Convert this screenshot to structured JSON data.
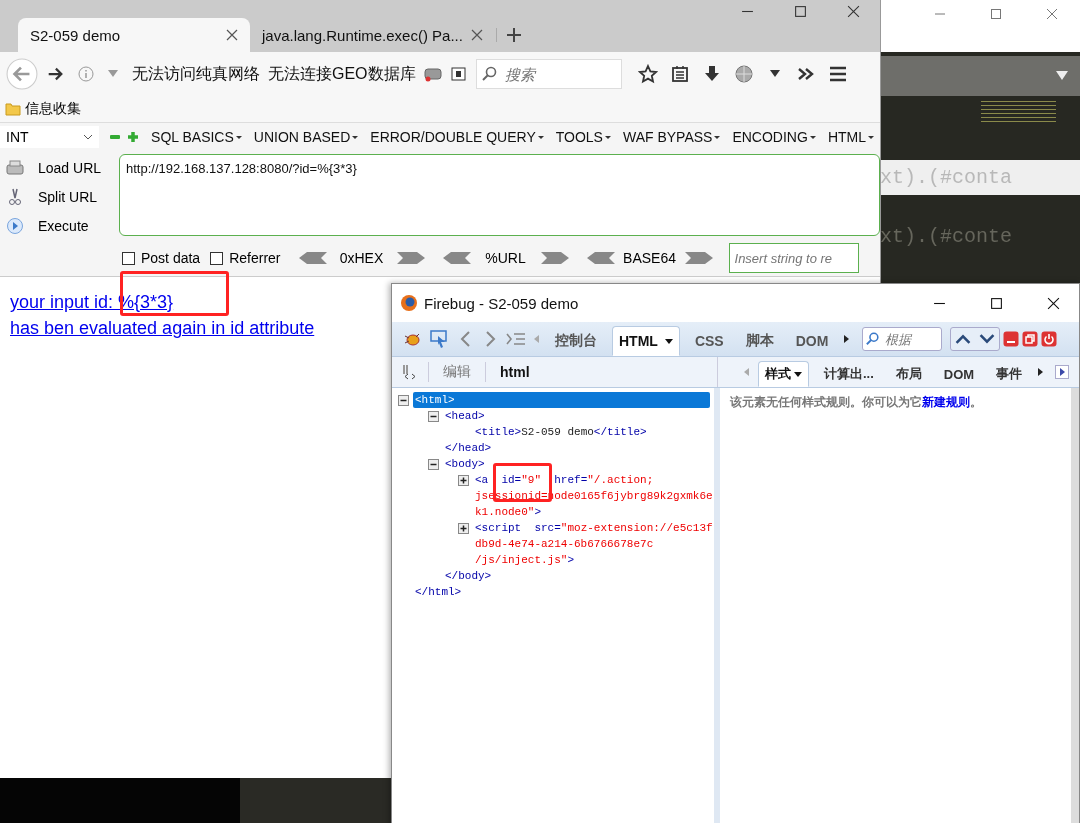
{
  "editor": {
    "code_lines": [
      "xt).(#conta",
      "xt).(#conte"
    ]
  },
  "browser": {
    "tabs": [
      {
        "label": "S2-059 demo",
        "selected": true
      },
      {
        "label": "java.lang.Runtime.exec() Pa...",
        "selected": false
      }
    ],
    "status_texts": [
      "无法访问纯真网络",
      "无法连接GEO数据库"
    ],
    "search": {
      "placeholder": "搜索"
    },
    "bookmarks": [
      "信息收集"
    ],
    "hackbar": {
      "select": "INT",
      "menus": [
        "SQL BASICS",
        "UNION BASED",
        "ERROR/DOUBLE QUERY",
        "TOOLS",
        "WAF BYPASS",
        "ENCODING",
        "HTML"
      ],
      "actions": [
        {
          "kind": "load",
          "label": "Load URL"
        },
        {
          "kind": "split",
          "label": "Split URL"
        },
        {
          "kind": "execute",
          "label": "Execute"
        }
      ],
      "url": "http://192.168.137.128:8080/?id=%{3*3}",
      "options": [
        {
          "label": "Post data",
          "checked": false
        },
        {
          "label": "Referrer",
          "checked": false
        }
      ],
      "encoders": [
        "0xHEX",
        "%URL",
        "BASE64"
      ],
      "insert": {
        "placeholder": "Insert string to re"
      }
    },
    "page_lines": [
      "your input id: %{3*3}",
      "has ben evaluated again in id attribute"
    ]
  },
  "firebug": {
    "title": "Firebug - S2-059 demo",
    "panels": [
      {
        "label": "控制台",
        "selected": false
      },
      {
        "label": "HTML",
        "selected": true
      },
      {
        "label": "CSS",
        "selected": false
      },
      {
        "label": "脚本",
        "selected": false
      },
      {
        "label": "DOM",
        "selected": false
      }
    ],
    "search": {
      "placeholder": "根据"
    },
    "edit": "编辑",
    "breadcrumb": "html",
    "side_tabs": [
      {
        "label": "样式",
        "selected": true
      },
      {
        "label": "计算出...",
        "selected": false
      },
      {
        "label": "布局",
        "selected": false
      },
      {
        "label": "DOM",
        "selected": false
      },
      {
        "label": "事件",
        "selected": false
      }
    ],
    "tree": [
      {
        "kind": "element",
        "expanded": true,
        "selected": true,
        "lines": [
          [
            {
              "kind": "tag",
              "text": "<html>"
            }
          ]
        ],
        "close": [
          {
            "kind": "tag",
            "text": "</html>"
          }
        ],
        "children": [
          {
            "kind": "element",
            "expanded": true,
            "selected": false,
            "lines": [
              [
                {
                  "kind": "tag",
                  "text": "<head>"
                }
              ]
            ],
            "close": [
              {
                "kind": "tag",
                "text": "</head>"
              }
            ],
            "children": [
              {
                "kind": "leaf",
                "selected": false,
                "lines": [
                  [
                    {
                      "kind": "tag",
                      "text": "<title>"
                    },
                    {
                      "kind": "text",
                      "text": "S2-059 demo"
                    },
                    {
                      "kind": "tag",
                      "text": "</title>"
                    }
                  ]
                ]
              }
            ]
          },
          {
            "kind": "element",
            "expanded": true,
            "selected": false,
            "lines": [
              [
                {
                  "kind": "tag",
                  "text": "<body>"
                }
              ]
            ],
            "close": [
              {
                "kind": "tag",
                "text": "</body>"
              }
            ],
            "children": [
              {
                "kind": "element",
                "expanded": false,
                "selected": false,
                "lines": [
                  [
                    {
                      "kind": "tag",
                      "text": "<a "
                    },
                    {
                      "kind": "attr",
                      "text": " id="
                    },
                    {
                      "kind": "value",
                      "text": "\"9\""
                    },
                    {
                      "kind": "attr",
                      "text": "  href="
                    },
                    {
                      "kind": "value",
                      "text": "\"/.action;"
                    }
                  ],
                  [
                    {
                      "kind": "value",
                      "text": "jsessionid=node0165f6jybrg89k2gxmk6e"
                    }
                  ],
                  [
                    {
                      "kind": "value",
                      "text": "k1.node0\""
                    },
                    {
                      "kind": "tag",
                      "text": ">"
                    }
                  ]
                ]
              },
              {
                "kind": "element",
                "expanded": false,
                "selected": false,
                "lines": [
                  [
                    {
                      "kind": "tag",
                      "text": "<script"
                    },
                    {
                      "kind": "attr",
                      "text": "  src="
                    },
                    {
                      "kind": "value",
                      "text": "\"moz-extension://e5c13f"
                    }
                  ],
                  [
                    {
                      "kind": "value",
                      "text": "db9d-4e74-a214-6b6766678e7c"
                    }
                  ],
                  [
                    {
                      "kind": "value",
                      "text": "/js/inject.js\""
                    },
                    {
                      "kind": "tag",
                      "text": ">"
                    }
                  ]
                ]
              }
            ]
          }
        ]
      }
    ],
    "style_note": {
      "text": "该元素无任何样式规则。你可以为它",
      "link": "新建规则",
      "tail": "。"
    }
  }
}
